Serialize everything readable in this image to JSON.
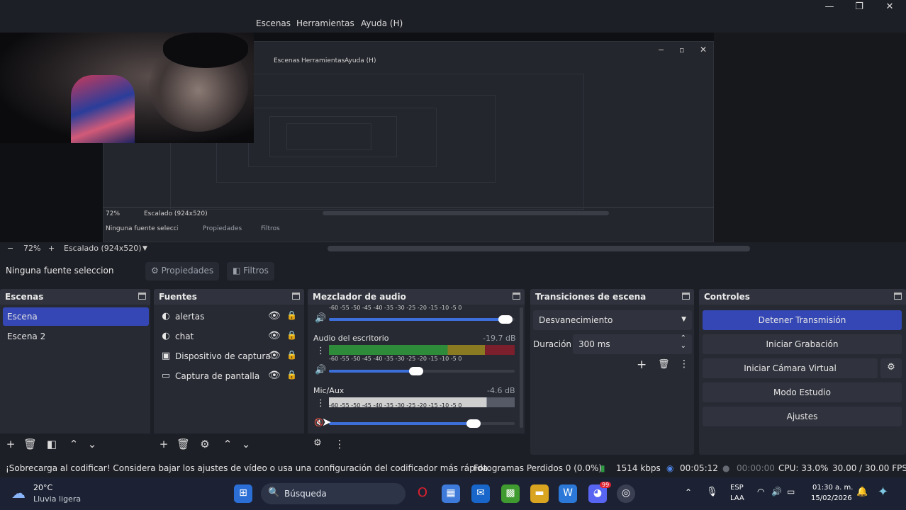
{
  "menu": {
    "scenes": "Escenas",
    "tools": "Herramientas",
    "help": "Ayuda (H)"
  },
  "window_controls": {
    "minimize": "—",
    "maximize": "❐",
    "close": "✕"
  },
  "nested_preview": {
    "menu": [
      "Escenas",
      "Herramientas",
      "Ayuda (H)"
    ],
    "zoom": "72%",
    "scale": "Escalado (924x520)",
    "no_source": "Ninguna fuente seleccionada",
    "properties": "Propiedades",
    "filters": "Filtros"
  },
  "zoom": {
    "minus": "−",
    "value": "72%",
    "plus": "+",
    "scale": "Escalado (924x520)"
  },
  "source_toolbar": {
    "no_source": "Ninguna fuente seleccionada",
    "properties": "Propiedades",
    "filters": "Filtros"
  },
  "scenes": {
    "title": "Escenas",
    "items": [
      {
        "label": "Escena",
        "active": true
      },
      {
        "label": "Escena 2",
        "active": false
      }
    ]
  },
  "sources": {
    "title": "Fuentes",
    "items": [
      {
        "label": "alertas",
        "icon": "browser-icon"
      },
      {
        "label": "chat",
        "icon": "browser-icon"
      },
      {
        "label": "Dispositivo de captura",
        "icon": "camera-icon"
      },
      {
        "label": "Captura de pantalla",
        "icon": "monitor-icon"
      }
    ]
  },
  "mixer": {
    "title": "Mezclador de audio",
    "ticks": "-60 -55 -50 -45 -40 -35 -30 -25 -20 -15 -10 -5 0",
    "channels": [
      {
        "name": "",
        "db": "",
        "volume": 0.95
      },
      {
        "name": "Audio del escritorio",
        "db": "-19.7 dB",
        "volume": 0.47
      },
      {
        "name": "Mic/Aux",
        "db": "-4.6 dB",
        "volume": 0.78
      }
    ]
  },
  "transitions": {
    "title": "Transiciones de escena",
    "selected": "Desvanecimiento",
    "duration_label": "Duración",
    "duration_value": "300 ms"
  },
  "controls": {
    "title": "Controles",
    "stop_stream": "Detener Transmisión",
    "start_recording": "Iniciar Grabación",
    "start_virtual_cam": "Iniciar Cámara Virtual",
    "studio_mode": "Modo Estudio",
    "settings": "Ajustes"
  },
  "status": {
    "warning": "¡Sobrecarga al codificar! Considera bajar los ajustes de vídeo o usa una configuración del codificador más rápida.",
    "dropped_frames": "Fotogramas Perdidos 0 (0.0%)",
    "bitrate": "1514 kbps",
    "stream_time": "00:05:12",
    "record_time": "00:00:00",
    "cpu": "CPU: 33.0%",
    "fps": "30.00 / 30.00 FPS"
  },
  "taskbar": {
    "weather_temp": "20°C",
    "weather_desc": "Lluvia ligera",
    "search": "Búsqueda",
    "lang_top": "ESP",
    "lang_bottom": "LAA",
    "time": "01:30 a. m.",
    "date": "15/02/2026",
    "discord_badge": "99",
    "colors": {
      "accent": "#3547b4",
      "taskbar": "#1c2233"
    }
  }
}
